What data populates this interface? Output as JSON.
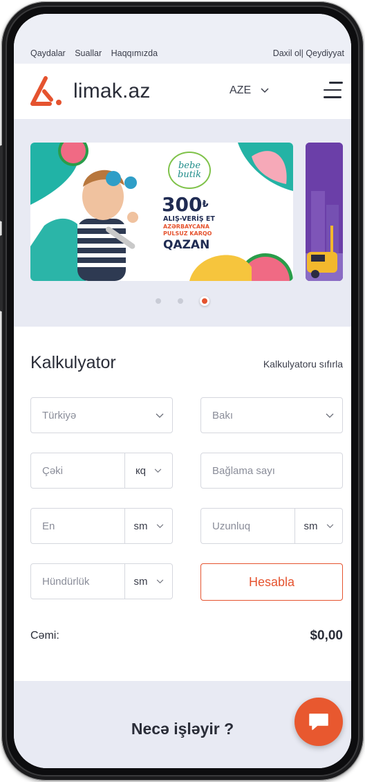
{
  "top_links": {
    "rules": "Qaydalar",
    "faq": "Suallar",
    "about": "Haqqımızda",
    "login": "Daxil ol|",
    "register": "Qeydiyyat"
  },
  "header": {
    "brand": "limak.az",
    "language": "AZE"
  },
  "banner": {
    "brand_line1": "bebe",
    "brand_line2": "butik",
    "amount": "300",
    "currency_sign": "₺",
    "line1": "ALIŞ-VERİŞ ET",
    "line2": "AZƏRBAYCANA",
    "line3": "PULSUZ KARQO",
    "line4": "QAZAN",
    "active_slide": 3,
    "slide_count": 3
  },
  "calculator": {
    "title": "Kalkulyator",
    "reset": "Kalkulyatoru sıfırla",
    "from_country": "Türkiyə",
    "to_city": "Bakı",
    "weight_placeholder": "Çəki",
    "weight_unit": "кq",
    "packages_placeholder": "Bağlama sayı",
    "width_placeholder": "En",
    "width_unit": "sm",
    "length_placeholder": "Uzunluq",
    "length_unit": "sm",
    "height_placeholder": "Hündürlük",
    "height_unit": "sm",
    "calculate": "Hesabla",
    "total_label": "Cəmi:",
    "total_value": "$0,00"
  },
  "how_it_works": {
    "title": "Necə işləyir ?"
  },
  "colors": {
    "accent": "#e5532f",
    "text": "#2a2d38",
    "background_band": "#e8eaf3"
  }
}
